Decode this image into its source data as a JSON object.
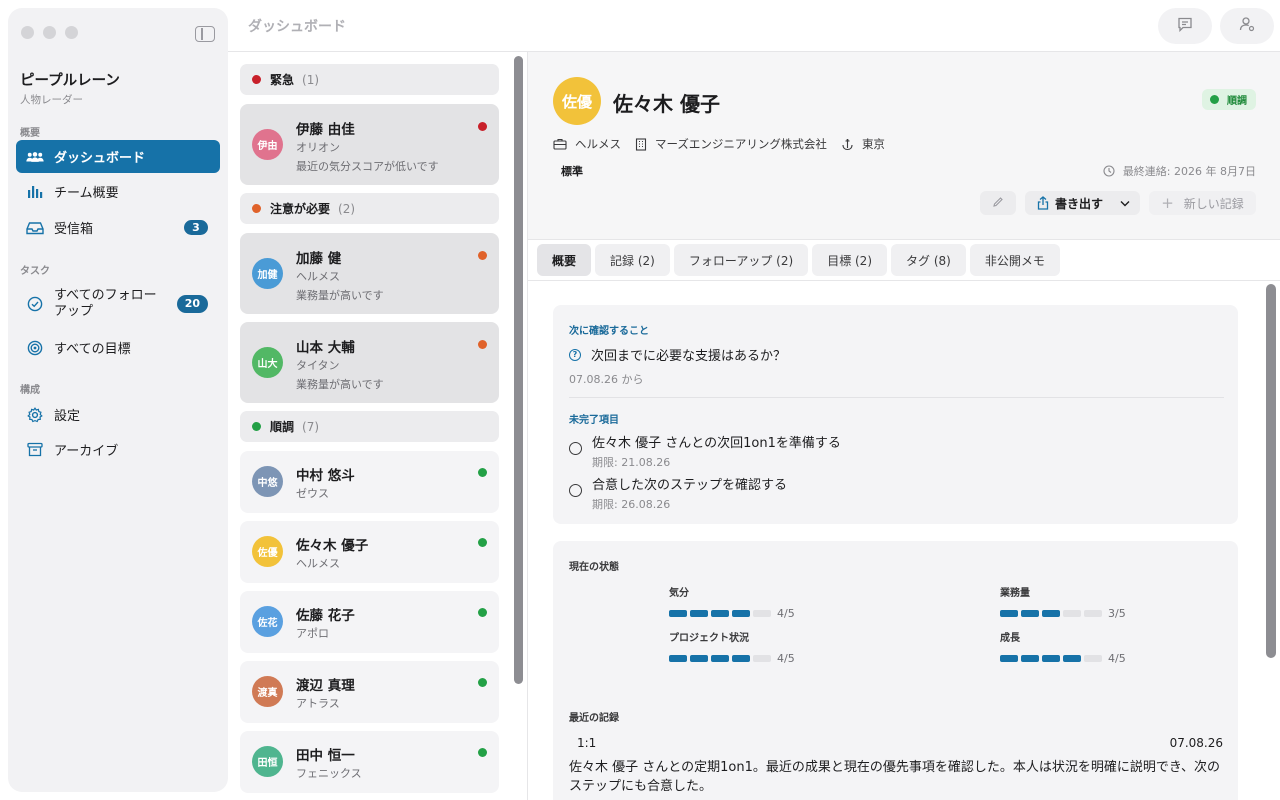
{
  "sidebar": {
    "app_title": "ピープルレーン",
    "app_subtitle": "人物レーダー",
    "sections": {
      "overview": "概要",
      "tasks": "タスク",
      "config": "構成"
    },
    "items": [
      {
        "label": "ダッシュボード",
        "icon": "people-icon",
        "active": true
      },
      {
        "label": "チーム概要",
        "icon": "bar-chart-icon"
      },
      {
        "label": "受信箱",
        "icon": "inbox-icon",
        "badge": "3"
      },
      {
        "label": "すべてのフォローアップ",
        "icon": "check-circle-icon",
        "badge": "20"
      },
      {
        "label": "すべての目標",
        "icon": "target-icon"
      },
      {
        "label": "設定",
        "icon": "gear-icon"
      },
      {
        "label": "アーカイブ",
        "icon": "archive-icon"
      }
    ]
  },
  "header": {
    "title": "ダッシュボード",
    "buttons": [
      {
        "icon": "chat-icon"
      },
      {
        "icon": "person-settings-icon"
      }
    ]
  },
  "colors": {
    "accent": "#1672a8",
    "urgent": "#c8202a",
    "warning": "#e0622a",
    "good": "#23a046"
  },
  "groups": [
    {
      "label": "緊急",
      "count": "(1)",
      "color": "#c8202a"
    },
    {
      "label": "注意が必要",
      "count": "(2)",
      "color": "#e0622a"
    },
    {
      "label": "順調",
      "count": "(7)",
      "color": "#23a046"
    }
  ],
  "people": [
    {
      "initials": "伊由",
      "name": "伊藤 由佳",
      "team": "オリオン",
      "note": "最近の気分スコアが低いです",
      "avatar_color": "#e0738e",
      "status_color": "#c8202a"
    },
    {
      "initials": "加健",
      "name": "加藤 健",
      "team": "ヘルメス",
      "note": "業務量が高いです",
      "avatar_color": "#4a9bd6",
      "status_color": "#e0622a"
    },
    {
      "initials": "山大",
      "name": "山本 大輔",
      "team": "タイタン",
      "note": "業務量が高いです",
      "avatar_color": "#52b865",
      "status_color": "#e0622a"
    },
    {
      "initials": "中悠",
      "name": "中村 悠斗",
      "team": "ゼウス",
      "note": "",
      "avatar_color": "#7d95b5",
      "status_color": "#23a046"
    },
    {
      "initials": "佐優",
      "name": "佐々木 優子",
      "team": "ヘルメス",
      "note": "",
      "avatar_color": "#f2c23a",
      "status_color": "#23a046"
    },
    {
      "initials": "佐花",
      "name": "佐藤 花子",
      "team": "アポロ",
      "note": "",
      "avatar_color": "#5aa0e0",
      "status_color": "#23a046"
    },
    {
      "initials": "渡真",
      "name": "渡辺 真理",
      "team": "アトラス",
      "note": "",
      "avatar_color": "#d07a55",
      "status_color": "#23a046"
    },
    {
      "initials": "田恒",
      "name": "田中 恒一",
      "team": "フェニックス",
      "note": "",
      "avatar_color": "#4fb58f",
      "status_color": "#23a046"
    }
  ],
  "detail": {
    "initials": "佐優",
    "name": "佐々木 優子",
    "status": "順調",
    "team": "ヘルメス",
    "company": "マーズエンジニアリング株式会社",
    "location": "東京",
    "level": "標準",
    "last_contact": "最終連絡: 2026 年 8月7日",
    "export_label": "書き出す",
    "new_record_label": "新しい記録",
    "tabs": [
      "概要",
      "記録 (2)",
      "フォローアップ (2)",
      "目標 (2)",
      "タグ (8)",
      "非公開メモ"
    ],
    "next_check": {
      "label": "次に確認すること",
      "question": "次回までに必要な支援はあるか？",
      "since": "07.08.26 から"
    },
    "open_items": {
      "label": "未完了項目",
      "items": [
        {
          "title": "佐々木 優子 さんとの次回1on1を準備する",
          "due": "期限: 21.08.26"
        },
        {
          "title": "合意した次のステップを確認する",
          "due": "期限: 26.08.26"
        }
      ]
    },
    "current_state": {
      "label": "現在の状態",
      "metrics": [
        {
          "label": "気分",
          "value": 4,
          "max": 5,
          "text": "4/5"
        },
        {
          "label": "業務量",
          "value": 3,
          "max": 5,
          "text": "3/5"
        },
        {
          "label": "プロジェクト状況",
          "value": 4,
          "max": 5,
          "text": "4/5"
        },
        {
          "label": "成長",
          "value": 4,
          "max": 5,
          "text": "4/5"
        }
      ]
    },
    "recent_records": {
      "label": "最近の記録",
      "type": "1:1",
      "date": "07.08.26",
      "text": "佐々木 優子 さんとの定期1on1。最近の成果と現在の優先事項を確認した。本人は状況を明確に説明でき、次のステップにも合意した。"
    }
  }
}
